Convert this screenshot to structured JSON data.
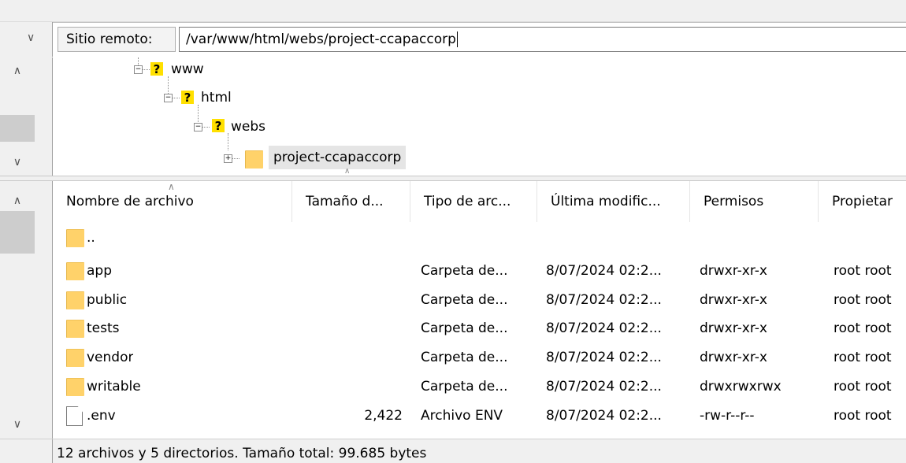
{
  "remote_site": {
    "label": "Sitio remoto:",
    "path": "/var/www/html/webs/project-ccapaccorp"
  },
  "tree": [
    {
      "name": "www",
      "icon": "question-folder-icon"
    },
    {
      "name": "html",
      "icon": "question-folder-icon"
    },
    {
      "name": "webs",
      "icon": "question-folder-icon"
    },
    {
      "name": "project-ccapaccorp",
      "icon": "folder-icon"
    }
  ],
  "columns": {
    "name": "Nombre de archivo",
    "size": "Tamaño d...",
    "type": "Tipo de arc...",
    "modified": "Última modific...",
    "perms": "Permisos",
    "owner": "Propietar"
  },
  "files": [
    {
      "name": "..",
      "size": "",
      "type": "",
      "modified": "",
      "perms": "",
      "owner": "",
      "icon": "folder-icon"
    },
    {
      "name": "app",
      "size": "",
      "type": "Carpeta de...",
      "modified": "8/07/2024 02:2...",
      "perms": "drwxr-xr-x",
      "owner": "root root",
      "icon": "folder-icon"
    },
    {
      "name": "public",
      "size": "",
      "type": "Carpeta de...",
      "modified": "8/07/2024 02:2...",
      "perms": "drwxr-xr-x",
      "owner": "root root",
      "icon": "folder-icon"
    },
    {
      "name": "tests",
      "size": "",
      "type": "Carpeta de...",
      "modified": "8/07/2024 02:2...",
      "perms": "drwxr-xr-x",
      "owner": "root root",
      "icon": "folder-icon"
    },
    {
      "name": "vendor",
      "size": "",
      "type": "Carpeta de...",
      "modified": "8/07/2024 02:2...",
      "perms": "drwxr-xr-x",
      "owner": "root root",
      "icon": "folder-icon"
    },
    {
      "name": "writable",
      "size": "",
      "type": "Carpeta de...",
      "modified": "8/07/2024 02:2...",
      "perms": "drwxrwxrwx",
      "owner": "root root",
      "icon": "folder-icon"
    },
    {
      "name": ".env",
      "size": "2,422",
      "type": "Archivo ENV",
      "modified": "8/07/2024 02:2...",
      "perms": "-rw-r--r--",
      "owner": "root root",
      "icon": "file-icon"
    }
  ],
  "status": "12 archivos y 5 directorios. Tamaño total: 99.685 bytes",
  "colors": {
    "folder": "#ffd26a",
    "question_badge": "#ffe000",
    "selected_bg": "#e5e5e5"
  }
}
